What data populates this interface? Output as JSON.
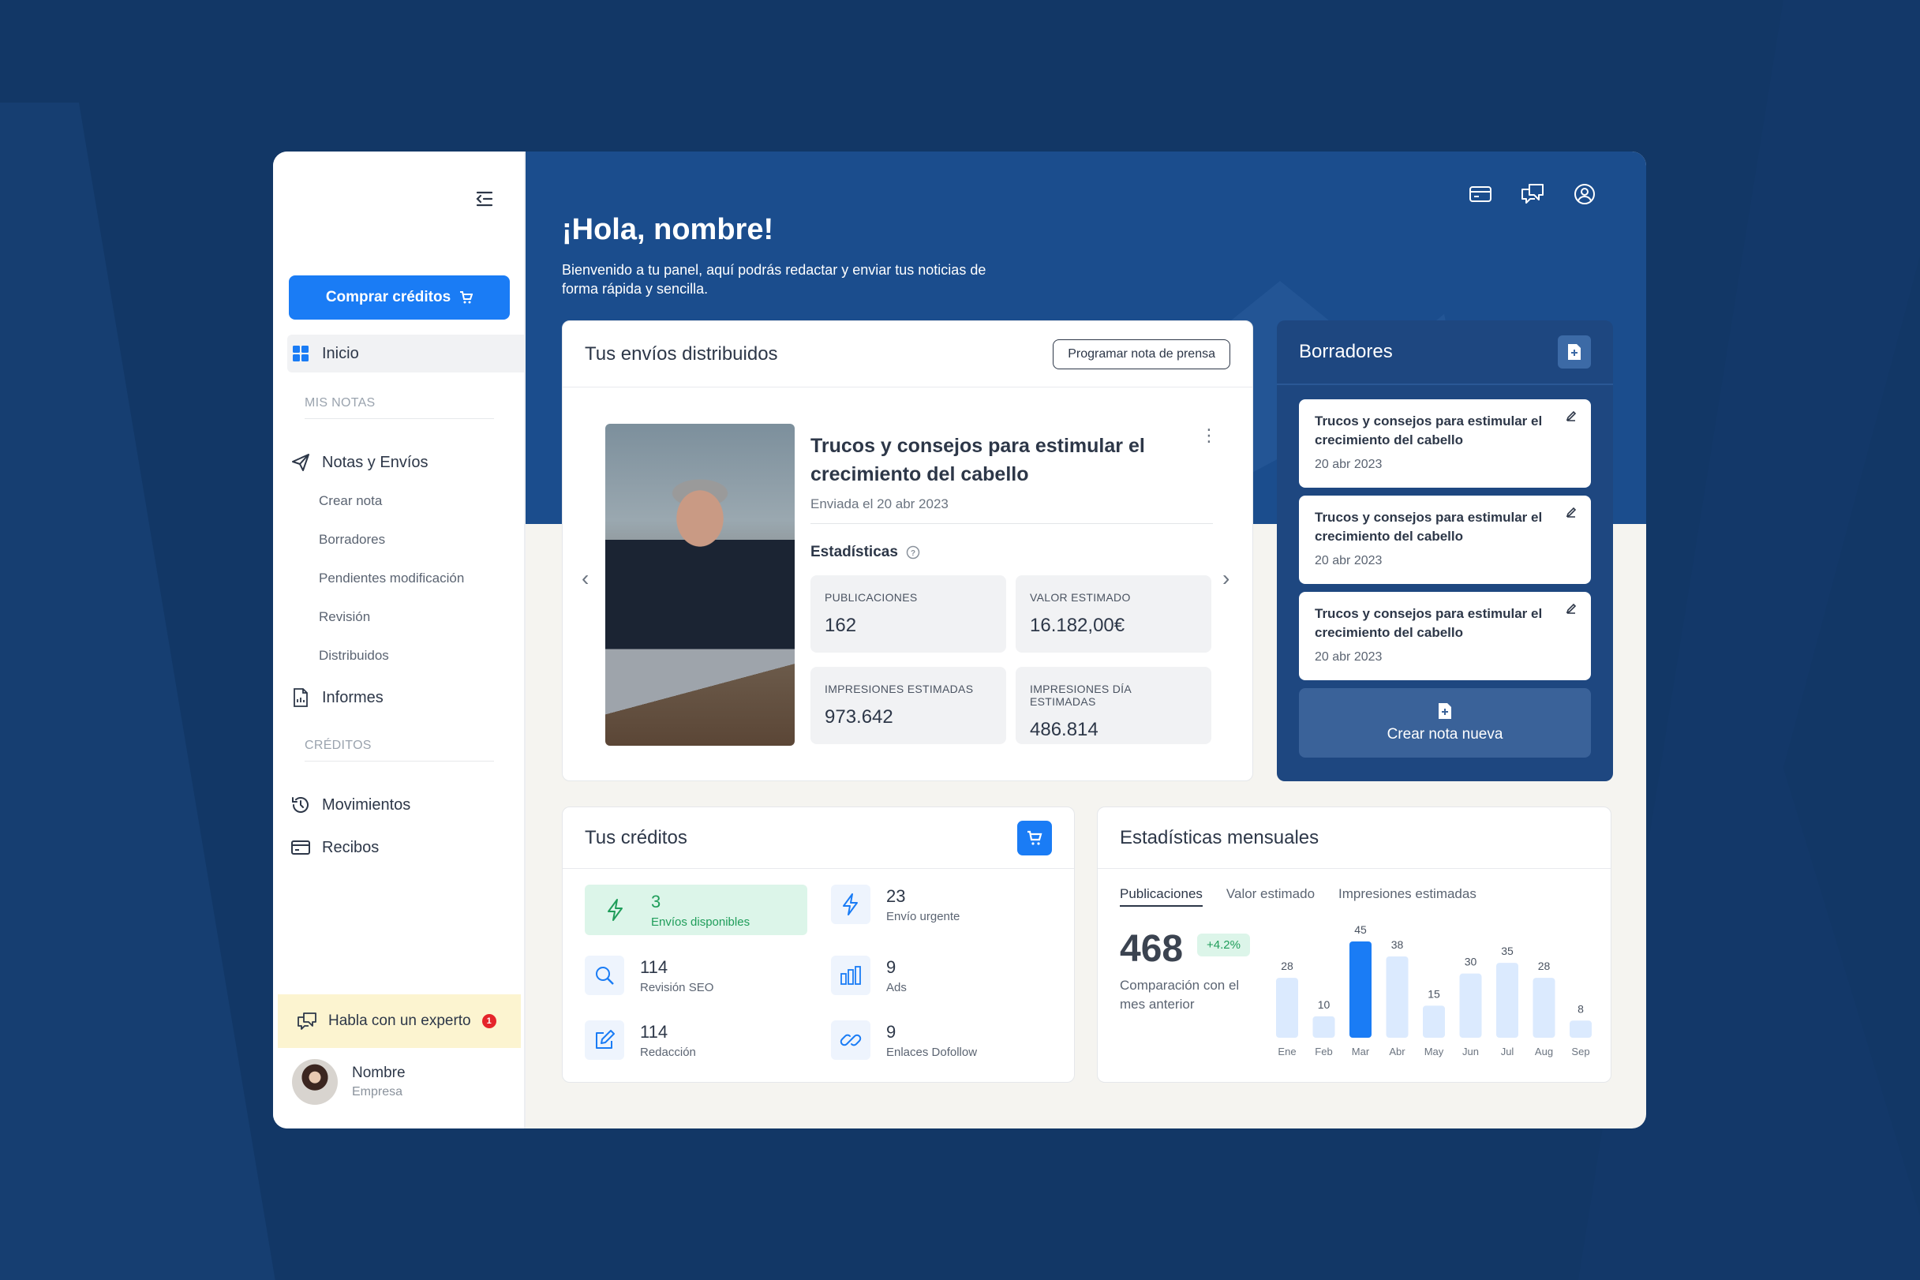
{
  "colors": {
    "page_bg": "#123766",
    "header_bg": "#1b4d8d",
    "accent": "#1a7cf5",
    "success": "#1f9d5a",
    "bar_light": "#dbeafe",
    "bar_active": "#1a7cf5"
  },
  "sidebar": {
    "collapse_icon": "collapse-menu-icon",
    "buy_button": "Comprar créditos",
    "home": "Inicio",
    "section_notes": "MIS NOTAS",
    "notes_and_sends": "Notas y Envíos",
    "sub_items": [
      "Crear nota",
      "Borradores",
      "Pendientes modificación",
      "Revisión",
      "Distribuidos"
    ],
    "reports": "Informes",
    "section_credits": "CRÉDITOS",
    "movements": "Movimientos",
    "receipts": "Recibos",
    "expert": "Habla con un experto",
    "expert_badge": "1",
    "user_name": "Nombre",
    "user_company": "Empresa"
  },
  "header": {
    "greeting": "¡Hola, nombre!",
    "welcome": "Bienvenido a tu panel, aquí podrás redactar y enviar tus noticias de forma rápida y sencilla.",
    "icons": [
      "card-icon",
      "chat-icon",
      "user-icon"
    ]
  },
  "sends": {
    "title": "Tus envíos distribuidos",
    "schedule_button": "Programar nota de prensa",
    "article_title": "Trucos y consejos para estimular el crecimiento del cabello",
    "article_date": "Enviada el 20 abr 2023",
    "stats_label": "Estadísticas",
    "stats": [
      {
        "label": "PUBLICACIONES",
        "value": "162"
      },
      {
        "label": "VALOR ESTIMADO",
        "value": "16.182,00€"
      },
      {
        "label": "IMPRESIONES ESTIMADAS",
        "value": "973.642"
      },
      {
        "label": "IMPRESIONES DÍA ESTIMADAS",
        "value": "486.814"
      }
    ]
  },
  "drafts": {
    "title": "Borradores",
    "items": [
      {
        "title": "Trucos y consejos para estimular el crecimiento del cabello",
        "date": "20 abr 2023"
      },
      {
        "title": "Trucos y consejos para estimular el crecimiento del cabello",
        "date": "20 abr 2023"
      },
      {
        "title": "Trucos y consejos para estimular el crecimiento del cabello",
        "date": "20 abr 2023"
      }
    ],
    "new_button": "Crear nota nueva"
  },
  "credits": {
    "title": "Tus créditos",
    "items": [
      {
        "num": "3",
        "label": "Envíos disponibles",
        "icon": "bolt-icon"
      },
      {
        "num": "23",
        "label": "Envío urgente",
        "icon": "bolt-icon"
      },
      {
        "num": "114",
        "label": "Revisión SEO",
        "icon": "search-icon"
      },
      {
        "num": "9",
        "label": "Ads",
        "icon": "bar-chart-icon"
      },
      {
        "num": "114",
        "label": "Redacción",
        "icon": "edit-icon"
      },
      {
        "num": "9",
        "label": "Enlaces Dofollow",
        "icon": "link-icon"
      }
    ]
  },
  "monthly": {
    "title": "Estadísticas mensuales",
    "tabs": [
      "Publicaciones",
      "Valor estimado",
      "Impresiones estimadas"
    ],
    "active_tab": "Publicaciones",
    "total": "468",
    "change": "+4.2%",
    "comparison": "Comparación con el mes anterior"
  },
  "chart_data": {
    "type": "bar",
    "categories": [
      "Ene",
      "Feb",
      "Mar",
      "Abr",
      "May",
      "Jun",
      "Jul",
      "Aug",
      "Sep"
    ],
    "values": [
      28,
      10,
      45,
      38,
      15,
      30,
      35,
      28,
      8
    ],
    "highlight_index": 2,
    "ylim": [
      0,
      45
    ],
    "grid": false
  }
}
